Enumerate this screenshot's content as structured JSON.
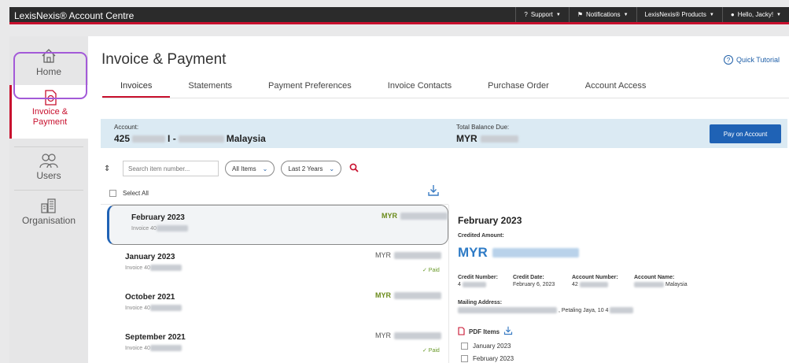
{
  "app": {
    "title": "LexisNexis® Account Centre"
  },
  "topnav": [
    {
      "label": "Support",
      "icon": "help-icon"
    },
    {
      "label": "Notifications",
      "icon": "flag-icon"
    },
    {
      "label": "LexisNexis® Products",
      "icon": ""
    },
    {
      "label": "Hello, Jacky!",
      "icon": "user-icon"
    }
  ],
  "sidebar": {
    "items": [
      {
        "label": "Home",
        "icon": "home-icon"
      },
      {
        "label_line1": "Invoice &",
        "label_line2": "Payment",
        "icon": "invoice-icon",
        "active": true
      },
      {
        "label": "Users",
        "icon": "users-icon"
      },
      {
        "label": "Organisation",
        "icon": "building-icon"
      }
    ]
  },
  "page": {
    "title": "Invoice & Payment",
    "quick_tutorial": "Quick Tutorial"
  },
  "tabs": [
    "Invoices",
    "Statements",
    "Payment Preferences",
    "Invoice Contacts",
    "Purchase Order",
    "Account Access"
  ],
  "account": {
    "label": "Account:",
    "value_prefix": "425",
    "value_sep": "I -",
    "value_suffix": "Malaysia",
    "balance_label": "Total Balance Due:",
    "balance_currency": "MYR",
    "pay_button": "Pay on Account"
  },
  "filters": {
    "search_placeholder": "Search item number...",
    "items_select": "All Items",
    "period_select": "Last 2 Years"
  },
  "list": {
    "select_all": "Select All",
    "rows": [
      {
        "month": "February 2023",
        "invoice": "Invoice 40",
        "currency": "MYR",
        "status": "",
        "selected": true
      },
      {
        "month": "January 2023",
        "invoice": "Invoice 40",
        "currency": "MYR",
        "status": "✓ Paid",
        "selected": false
      },
      {
        "month": "October 2021",
        "invoice": "Invoice 40",
        "currency": "MYR",
        "status": "",
        "selected": false
      },
      {
        "month": "September 2021",
        "invoice": "Invoice 40",
        "currency": "MYR",
        "status": "✓ Paid",
        "selected": false
      }
    ]
  },
  "detail": {
    "title": "February 2023",
    "credited_label": "Credited Amount:",
    "amount_currency": "MYR",
    "credit_number_label": "Credit Number:",
    "credit_number_value": "4",
    "credit_date_label": "Credit Date:",
    "credit_date_value": "February 6, 2023",
    "account_number_label": "Account Number:",
    "account_number_value": "42",
    "account_name_label": "Account Name:",
    "account_name_value": "Malaysia",
    "mailing_label": "Mailing Address:",
    "mailing_value": ", Petaling Jaya, 10 4",
    "pdf_label": "PDF Items",
    "pdf_items": [
      "January 2023",
      "February 2023"
    ]
  },
  "colors": {
    "accent_red": "#c8102e",
    "primary_blue": "#1f62b5",
    "banner_blue": "#dbeaf3",
    "paid_green": "#6a9a2a"
  }
}
